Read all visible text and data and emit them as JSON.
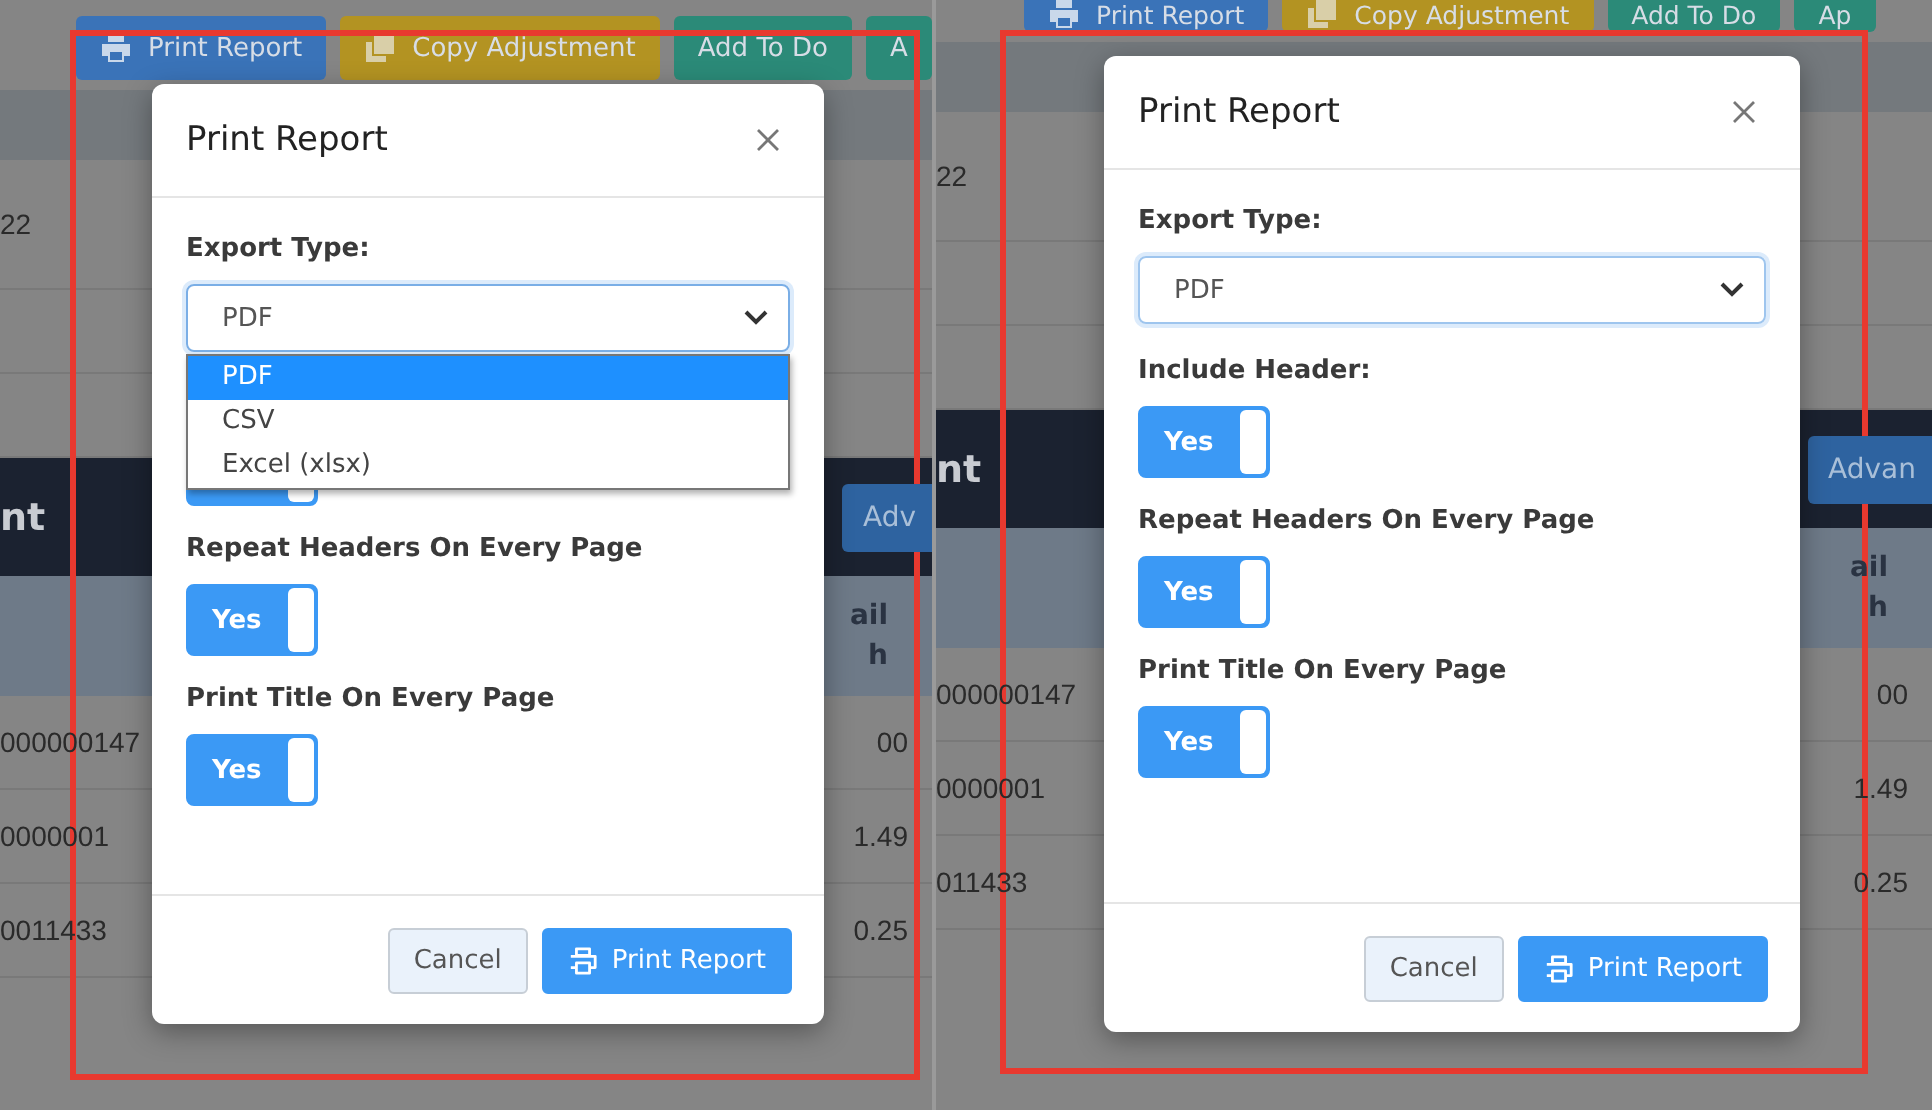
{
  "panels": [
    {
      "background": {
        "toolbar": [
          {
            "label": "Print Report",
            "color": "#3a73b8"
          },
          {
            "label": "Copy Adjustment",
            "color": "#b39322"
          },
          {
            "label": "Add To Do",
            "color": "#2b8a78"
          },
          {
            "label": "A",
            "color": "#2b8a78"
          }
        ],
        "date_cell": "22",
        "section_title": "nt",
        "section_button": "Adv",
        "column_header": [
          "ail",
          "h"
        ],
        "rows": [
          {
            "column_1": "000000147",
            "column_2": "00"
          },
          {
            "column_1": "0000001",
            "column_2": "1.49"
          },
          {
            "column_1": "0011433",
            "column_2": "0.25"
          }
        ]
      },
      "modal": {
        "title": "Print Report",
        "export_label": "Export Type:",
        "export_value": "PDF",
        "dropdown_open": true,
        "options": [
          {
            "label": "PDF",
            "selected": true
          },
          {
            "label": "CSV",
            "selected": false
          },
          {
            "label": "Excel (xlsx)",
            "selected": false
          }
        ],
        "toggles": [
          {
            "on": true
          },
          {
            "label": "Repeat Headers On Every Page",
            "text": "Yes",
            "on": true
          },
          {
            "label": "Print Title On Every Page",
            "text": "Yes",
            "on": true
          }
        ],
        "buttons": [
          {
            "label": "Cancel",
            "kind": "secondary"
          },
          {
            "label": "Print Report",
            "kind": "primary"
          }
        ]
      }
    },
    {
      "background": {
        "toolbar": [
          {
            "label": "Print Report",
            "color": "#3a73b8"
          },
          {
            "label": "Copy Adjustment",
            "color": "#b39322"
          },
          {
            "label": "Add To Do",
            "color": "#2b8a78"
          },
          {
            "label": "Ap",
            "color": "#2b8a78"
          }
        ],
        "date_cell": "22",
        "section_title": "nt",
        "section_button": "Advan",
        "column_header": [
          "ail",
          "h"
        ],
        "rows": [
          {
            "column_1": "000000147",
            "column_2": "00"
          },
          {
            "column_1": "0000001",
            "column_2": "1.49"
          },
          {
            "column_1": "011433",
            "column_2": "0.25"
          }
        ]
      },
      "modal": {
        "title": "Print Report",
        "export_label": "Export Type:",
        "export_value": "PDF",
        "dropdown_open": false,
        "toggles": [
          {
            "label": "Include Header:",
            "text": "Yes",
            "on": true
          },
          {
            "label": "Repeat Headers On Every Page",
            "text": "Yes",
            "on": true
          },
          {
            "label": "Print Title On Every Page",
            "text": "Yes",
            "on": true
          }
        ],
        "buttons": [
          {
            "label": "Cancel",
            "kind": "secondary"
          },
          {
            "label": "Print Report",
            "kind": "primary"
          }
        ]
      }
    }
  ]
}
